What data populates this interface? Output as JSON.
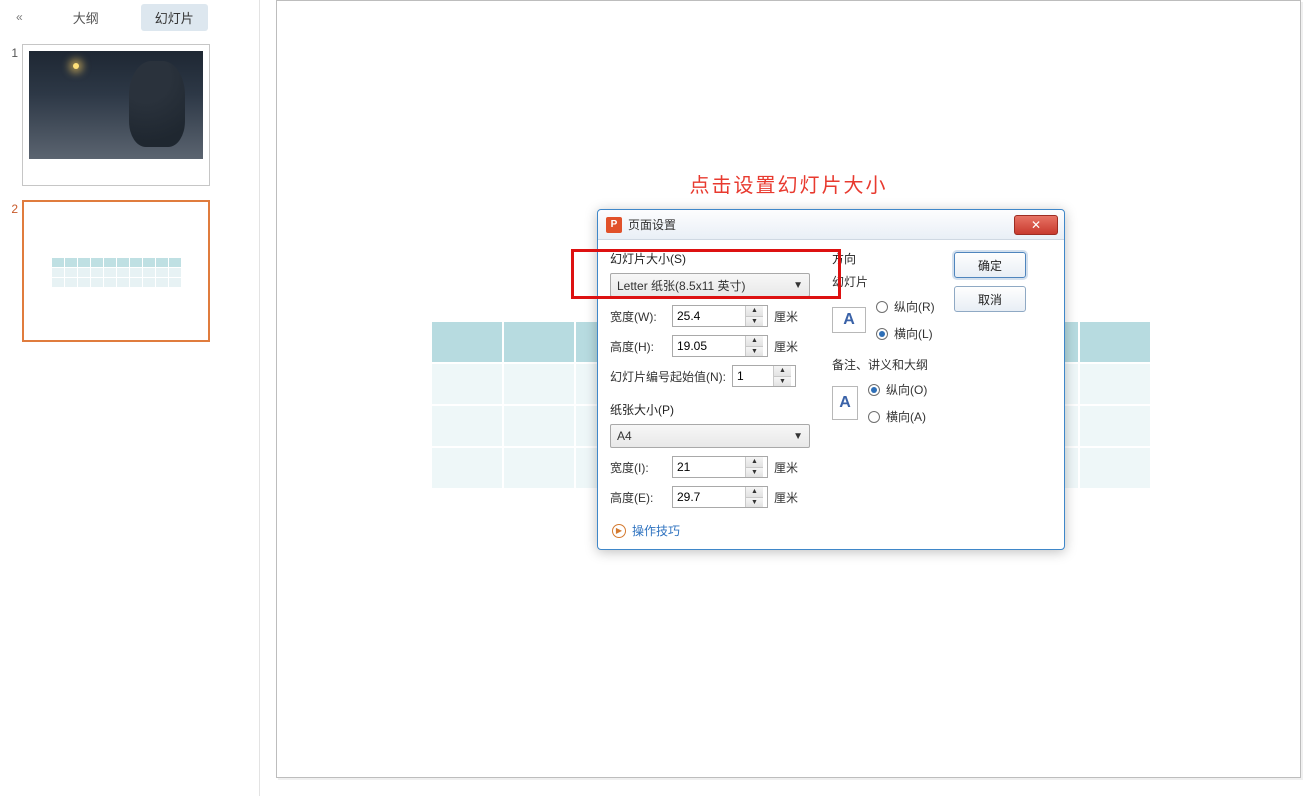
{
  "sidebar": {
    "tabs": {
      "outline": "大纲",
      "slides": "幻灯片"
    },
    "slideNumbers": [
      "1",
      "2"
    ]
  },
  "instruction": "点击设置幻灯片大小",
  "dialog": {
    "title": "页面设置",
    "slideSize": {
      "groupLabel": "幻灯片大小(S)",
      "selected": "Letter 纸张(8.5x11 英寸)",
      "widthLabel": "宽度(W):",
      "widthValue": "25.4",
      "heightLabel": "高度(H):",
      "heightValue": "19.05",
      "startNumLabel": "幻灯片编号起始值(N):",
      "startNumValue": "1",
      "unit": "厘米"
    },
    "paperSize": {
      "groupLabel": "纸张大小(P)",
      "selected": "A4",
      "widthLabel": "宽度(I):",
      "widthValue": "21",
      "heightLabel": "高度(E):",
      "heightValue": "29.7",
      "unit": "厘米"
    },
    "orientation": {
      "groupLabel": "方向",
      "slideLabel": "幻灯片",
      "notesLabel": "备注、讲义和大纲",
      "portrait_R": "纵向(R)",
      "landscape_L": "横向(L)",
      "portrait_O": "纵向(O)",
      "landscape_A": "横向(A)"
    },
    "buttons": {
      "ok": "确定",
      "cancel": "取消"
    },
    "footerLink": "操作技巧"
  }
}
